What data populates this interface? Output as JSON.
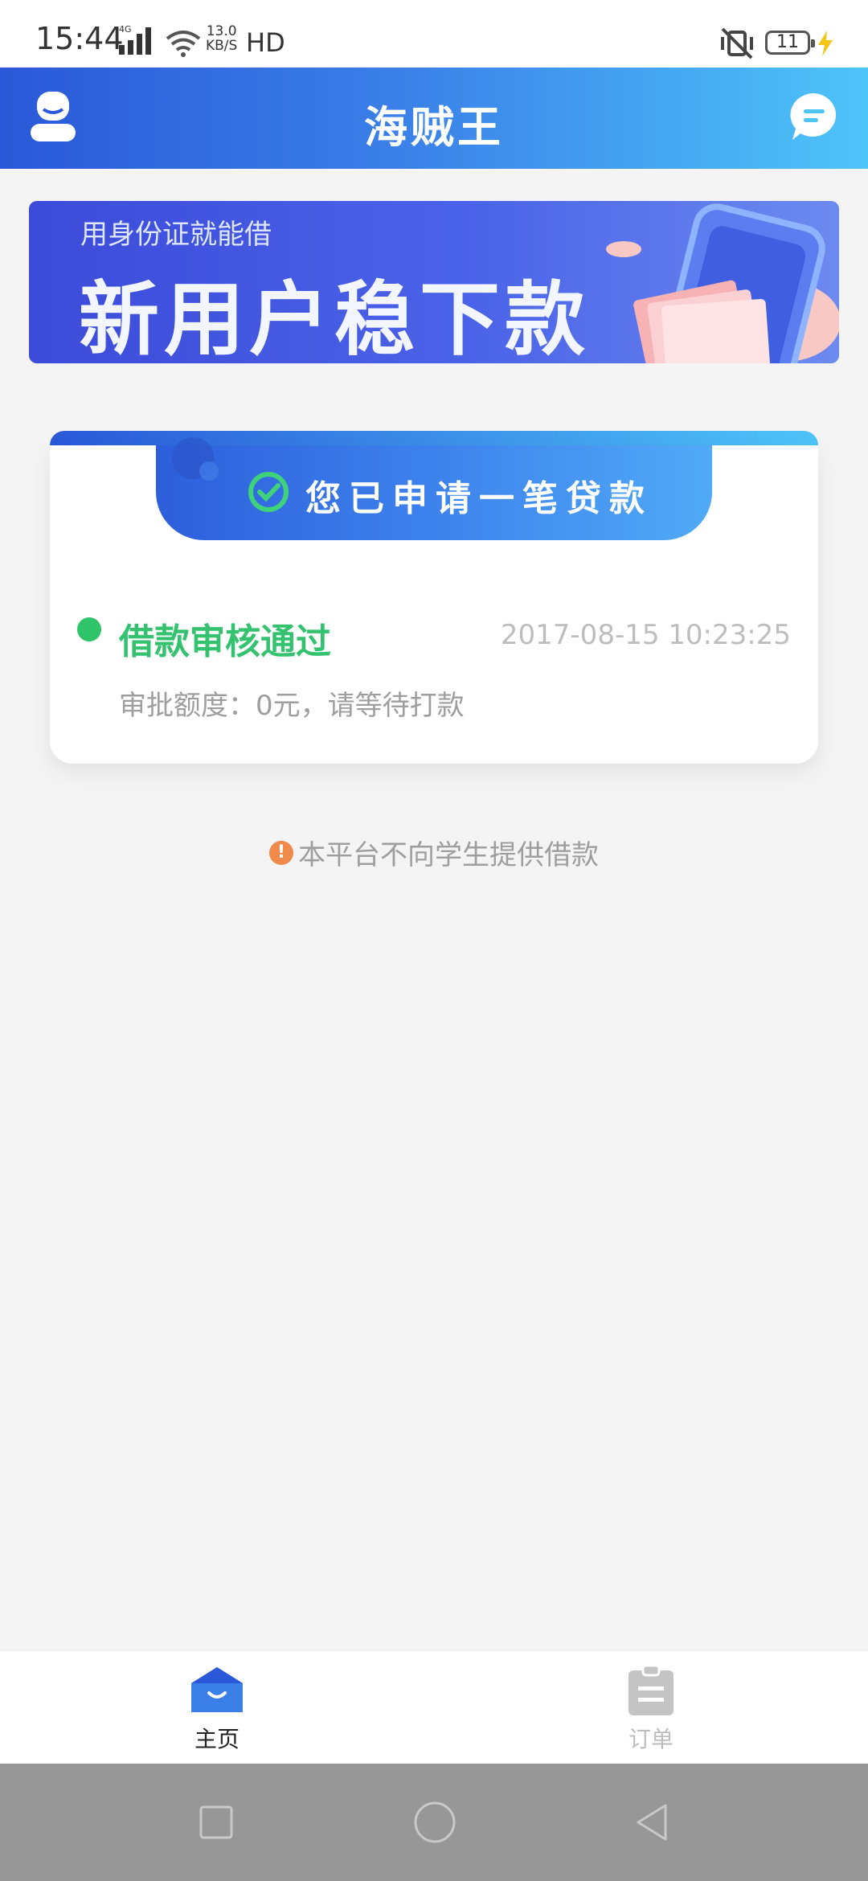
{
  "status_bar": {
    "time": "15:44",
    "network": "4G",
    "speed_value": "13.0",
    "speed_unit": "KB/S",
    "hd": "HD",
    "battery": "11"
  },
  "header": {
    "title": "海贼王",
    "user_icon": "user-icon",
    "message_icon": "message-icon"
  },
  "banner": {
    "subtitle": "用身份证就能借",
    "title": "新用户稳下款"
  },
  "loan_card": {
    "tab_text": "您已申请一笔贷款",
    "status_title": "借款审核通过",
    "status_time": "2017-08-15 10:23:25",
    "status_desc": "审批额度：0元，请等待打款",
    "status_color": "#35c270"
  },
  "notice": {
    "text": "本平台不向学生提供借款",
    "icon_text": "!"
  },
  "bottom_nav": {
    "items": [
      {
        "label": "主页",
        "icon": "home-icon",
        "active": true
      },
      {
        "label": "订单",
        "icon": "order-icon",
        "active": false
      }
    ],
    "active_color": "#222222",
    "inactive_color": "#bdbdbd"
  },
  "system_nav": {
    "buttons": [
      "recent-apps-icon",
      "home-circle-icon",
      "back-icon"
    ]
  },
  "colors": {
    "brand_gradient_start": "#2a58d8",
    "brand_gradient_end": "#4ec4f8",
    "background": "#f4f4f5"
  }
}
